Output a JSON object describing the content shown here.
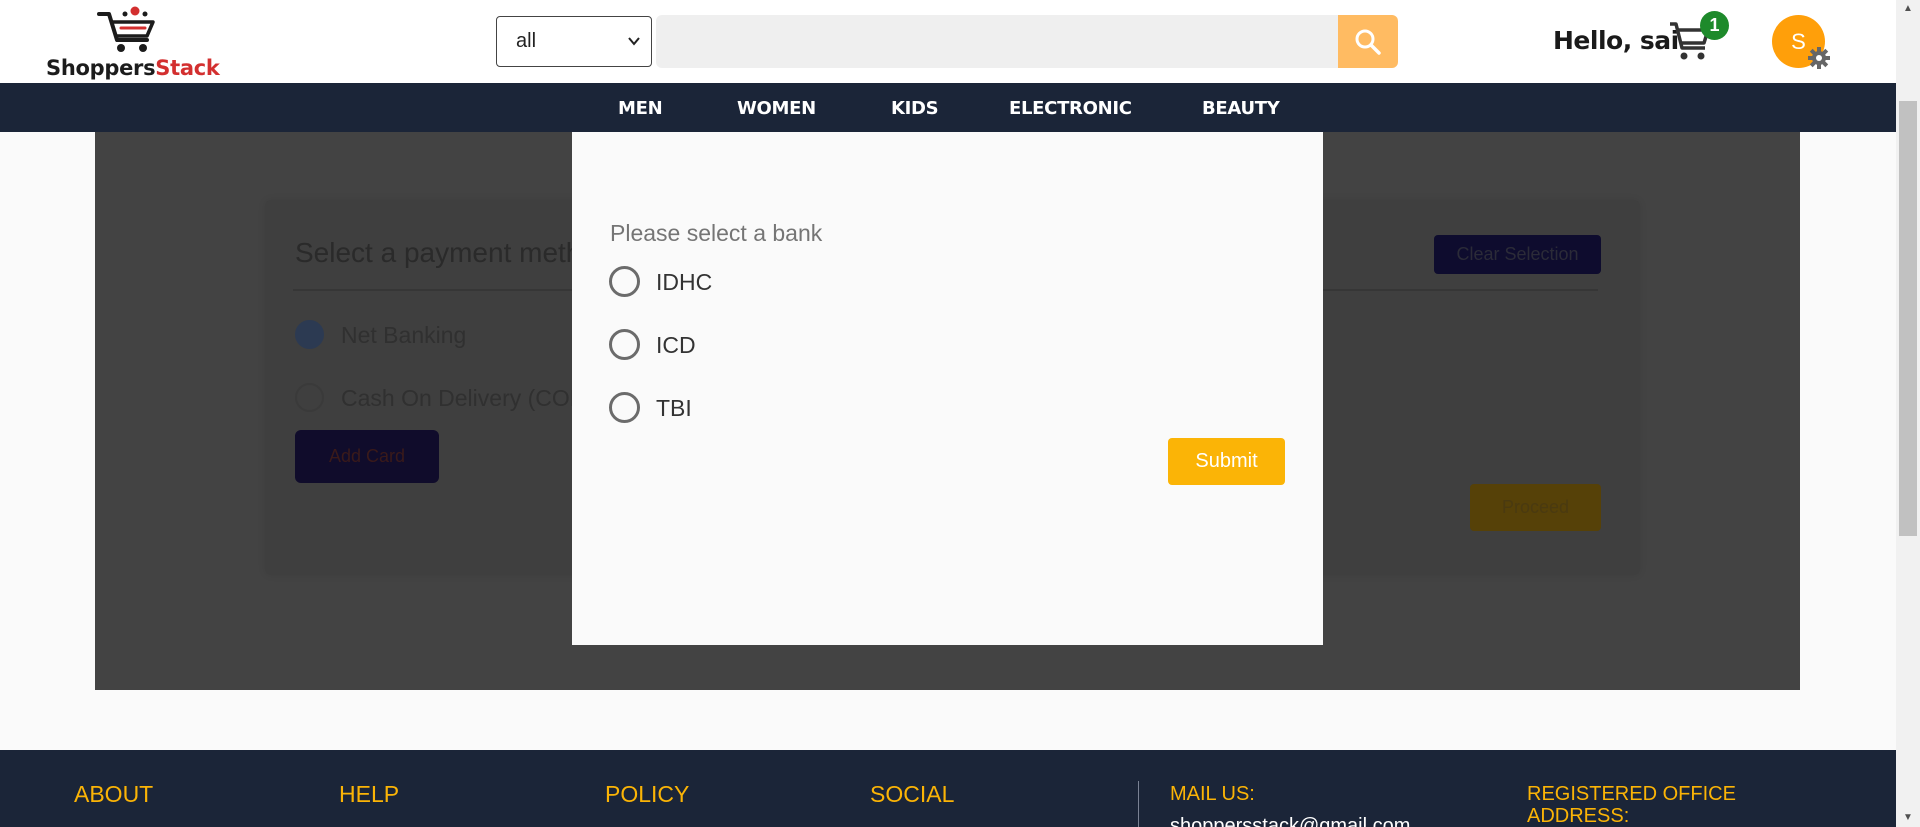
{
  "header": {
    "logo": {
      "part1": "Shoppers",
      "part2": "Stack"
    },
    "category_select": {
      "value": "all"
    },
    "search": {
      "placeholder": ""
    },
    "greeting": "Hello, sai",
    "cart_count": "1",
    "avatar_initial": "S"
  },
  "nav": {
    "items": [
      "MEN",
      "WOMEN",
      "KIDS",
      "ELECTRONIC",
      "BEAUTY"
    ]
  },
  "payment": {
    "title": "Select a payment method",
    "clear_label": "Clear Selection",
    "options": [
      "Net Banking",
      "Cash On Delivery (COD)"
    ],
    "add_card_label": "Add Card",
    "proceed_label": "Proceed"
  },
  "modal": {
    "title": "Please select a bank",
    "banks": [
      "IDHC",
      "ICD",
      "TBI"
    ],
    "submit_label": "Submit"
  },
  "footer": {
    "about": "ABOUT",
    "help": "HELP",
    "policy": "POLICY",
    "social": "SOCIAL",
    "mail_us": "MAIL US:",
    "registered_office_line1": "REGISTERED OFFICE",
    "registered_office_line2": "ADDRESS:",
    "mail_text": "shoppersstack@gmail.com"
  },
  "colors": {
    "accent": "#fbb406",
    "nav_bg": "#1b2538",
    "badge": "#1e8a2b",
    "avatar": "#ff9f0a"
  }
}
